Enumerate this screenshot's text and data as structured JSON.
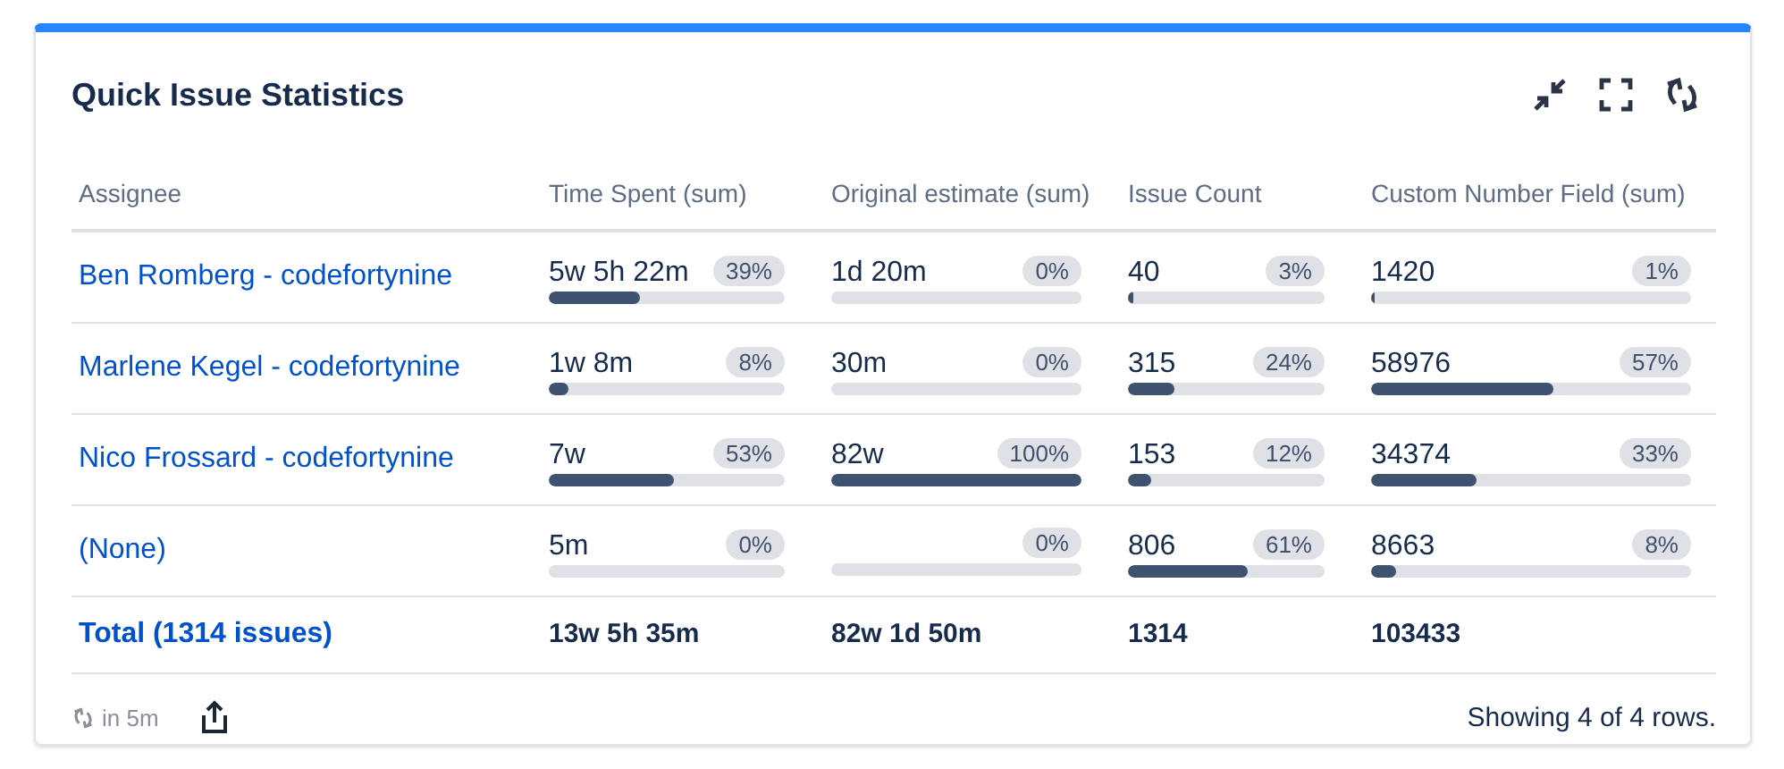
{
  "title": "Quick Issue Statistics",
  "columns": [
    "Assignee",
    "Time Spent (sum)",
    "Original estimate (sum)",
    "Issue Count",
    "Custom Number Field (sum)"
  ],
  "rows": [
    {
      "assignee": "Ben Romberg - codefortynine",
      "cells": [
        {
          "value": "5w 5h 22m",
          "percent": "39%",
          "level": 0.39
        },
        {
          "value": "1d 20m",
          "percent": "0%"
        },
        {
          "value": "40",
          "percent": "3%",
          "level": 0.03
        },
        {
          "value": "1420",
          "percent": "1%",
          "level": 0.01
        }
      ]
    },
    {
      "assignee": "Marlene Kegel - codefortynine",
      "cells": [
        {
          "value": "1w 8m",
          "percent": "8%",
          "level": 0.08
        },
        {
          "value": "30m",
          "percent": "0%"
        },
        {
          "value": "315",
          "percent": "24%",
          "level": 0.24
        },
        {
          "value": "58976",
          "percent": "57%",
          "level": 0.57
        }
      ]
    },
    {
      "assignee": "Nico Frossard - codefortynine",
      "cells": [
        {
          "value": "7w",
          "percent": "53%",
          "level": 0.53
        },
        {
          "value": "82w",
          "percent": "100%",
          "level": 1
        },
        {
          "value": "153",
          "percent": "12%",
          "level": 0.12
        },
        {
          "value": "34374",
          "percent": "33%",
          "level": 0.33
        }
      ]
    },
    {
      "assignee": "(None)",
      "cells": [
        {
          "value": "5m",
          "percent": "0%"
        },
        {
          "percent": "0%"
        },
        {
          "value": "806",
          "percent": "61%",
          "level": 0.61
        },
        {
          "value": "8663",
          "percent": "8%",
          "level": 0.08
        }
      ]
    }
  ],
  "total": {
    "label": "Total (1314 issues)",
    "values": [
      "13w 5h 35m",
      "82w 1d 50m",
      "1314",
      "103433"
    ]
  },
  "footer": {
    "refresh": "in 5m",
    "rows_info": "Showing 4 of 4 rows."
  }
}
